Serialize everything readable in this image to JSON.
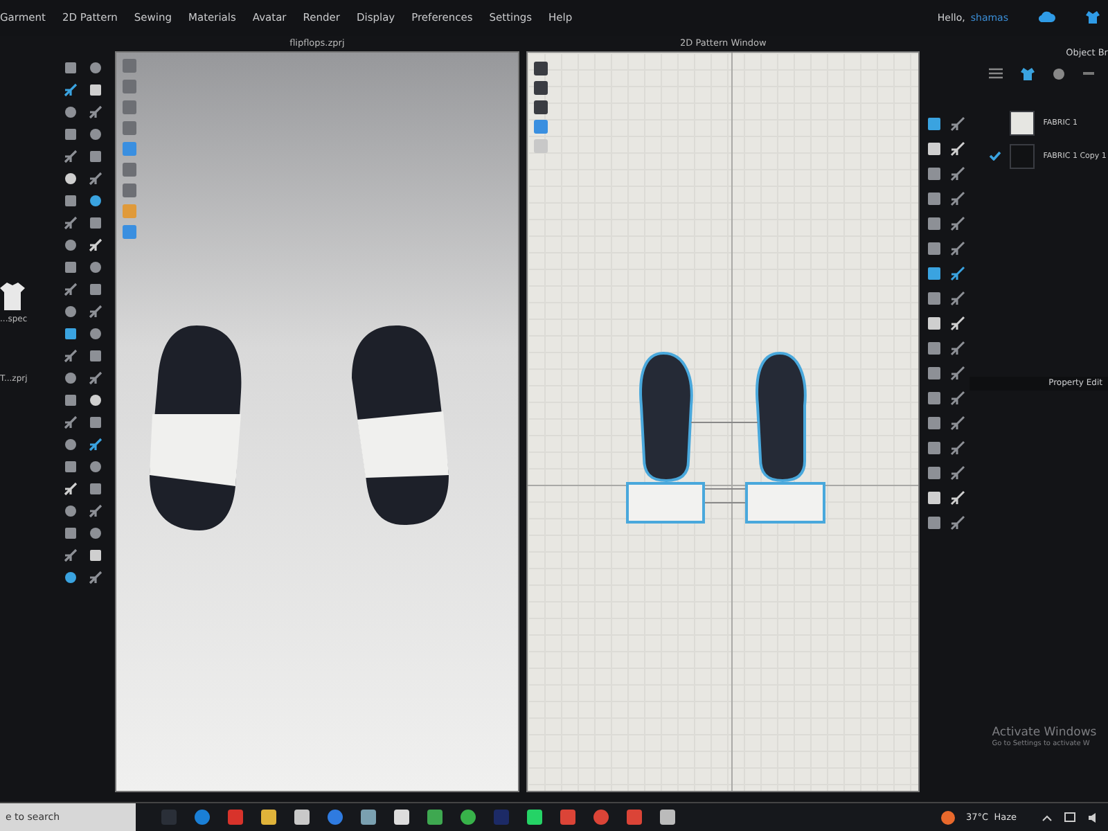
{
  "menu_bar": {
    "items": [
      "Garment",
      "2D Pattern",
      "Sewing",
      "Materials",
      "Avatar",
      "Render",
      "Display",
      "Preferences",
      "Settings",
      "Help"
    ],
    "greeting": "Hello,",
    "user": "shamas"
  },
  "library": {
    "items": [
      {
        "kind": "garment",
        "label": "...spec"
      },
      {
        "kind": "project",
        "label": "T...zprj"
      }
    ]
  },
  "viewport_3d": {
    "title": "flipflops.zprj"
  },
  "pattern_window": {
    "title": "2D Pattern Window"
  },
  "object_browser": {
    "title": "Object Br",
    "fabrics": [
      {
        "name": "FABRIC 1",
        "selected": false,
        "color": "#e6e6e2"
      },
      {
        "name": "FABRIC 1 Copy 1",
        "selected": true,
        "color": "#111214"
      }
    ]
  },
  "property_editor": {
    "title": "Property Edit"
  },
  "activation_notice": {
    "title": "Activate Windows",
    "subtitle": "Go to Settings to activate W"
  },
  "taskbar": {
    "search": {
      "placeholder": "e to search"
    },
    "weather": "37°C  Haze"
  }
}
